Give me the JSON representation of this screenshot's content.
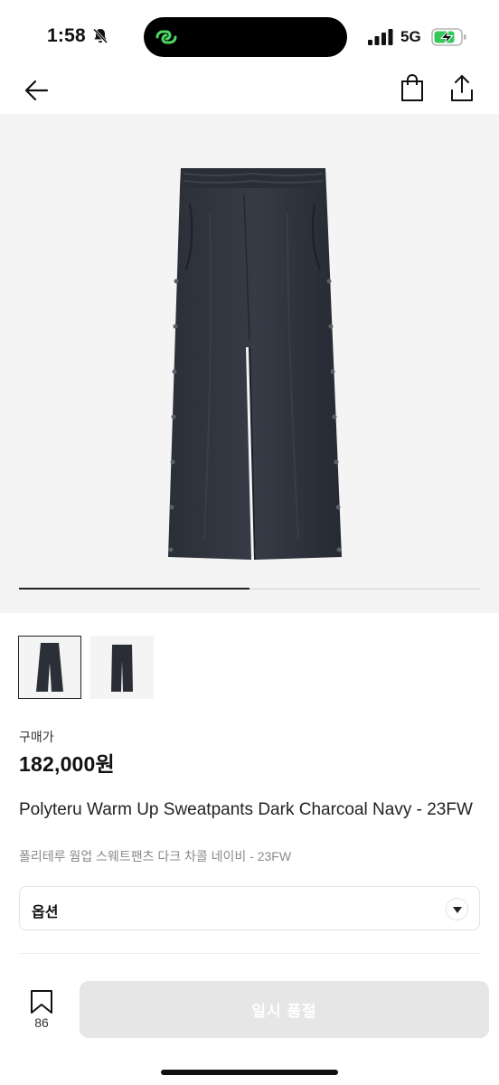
{
  "status_bar": {
    "time": "1:58",
    "network": "5G",
    "icons": [
      "bell-slash-icon",
      "app-island-icon",
      "signal-bars-icon",
      "battery-charging-icon"
    ],
    "accent_color": "#34c759"
  },
  "nav": {
    "back_icon": "arrow-left-icon",
    "bag_icon": "shopping-bag-icon",
    "share_icon": "share-icon"
  },
  "gallery": {
    "image": "navy-sweatpants-photo",
    "slide_progress": 0.5,
    "thumbnails": [
      "navy-sweatpants-front",
      "navy-sweatpants-flat"
    ],
    "selected_index": 0
  },
  "price": {
    "label": "구매가",
    "value": "182,000원"
  },
  "product": {
    "title_en": "Polyteru Warm Up Sweatpants Dark Charcoal Navy - 23FW",
    "title_ko": "폴리테루 웜업 스웨트팬츠 다크 차콜 네이비 - 23FW"
  },
  "options": {
    "label": "옵션"
  },
  "bottom_bar": {
    "bookmark_count": "86",
    "action_label": "일시 품절",
    "action_color": "#e6e6e6"
  }
}
